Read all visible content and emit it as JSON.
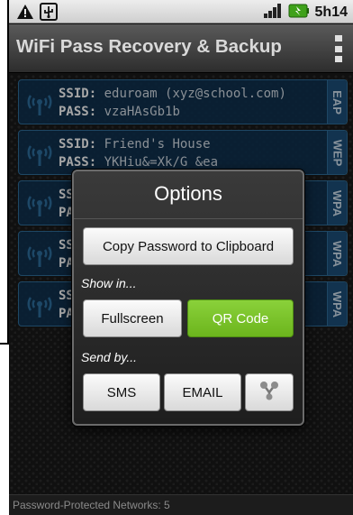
{
  "status_bar": {
    "time": "5h14",
    "icons": [
      "warning-icon",
      "usb-icon",
      "signal-icon",
      "battery-icon"
    ],
    "battery_color": "#3fa11a"
  },
  "app": {
    "title": "WiFi Pass Recovery & Backup"
  },
  "networks": [
    {
      "ssid_label": "SSID:",
      "ssid": " eduroam (xyz@school.com)",
      "pass_label": "PASS:",
      "pass": " vzaHAsGb1b",
      "type": "EAP"
    },
    {
      "ssid_label": "SSID:",
      "ssid": " Friend's House",
      "pass_label": "PASS:",
      "pass": " YKHiu&=Xk/G &ea",
      "type": "WEP"
    },
    {
      "ssid_label": "SS",
      "ssid": "",
      "pass_label": "PA",
      "pass": "",
      "type": "WPA"
    },
    {
      "ssid_label": "SS",
      "ssid": "",
      "pass_label": "PA",
      "pass": "",
      "type": "WPA"
    },
    {
      "ssid_label": "SS",
      "ssid": "",
      "pass_label": "PA",
      "pass": "",
      "type": "WPA"
    }
  ],
  "dialog": {
    "title": "Options",
    "copy_button": "Copy Password to Clipboard",
    "show_in_label": "Show in...",
    "fullscreen_button": "Fullscreen",
    "qr_button": "QR Code",
    "send_by_label": "Send by...",
    "sms_button": "SMS",
    "email_button": "EMAIL",
    "share_icon": "share-icon",
    "accent_color": "#7cc22b"
  },
  "footer": {
    "text": "Password-Protected Networks: 5"
  },
  "colors": {
    "card_bg": "#103454",
    "card_border": "#2f6e9a"
  }
}
